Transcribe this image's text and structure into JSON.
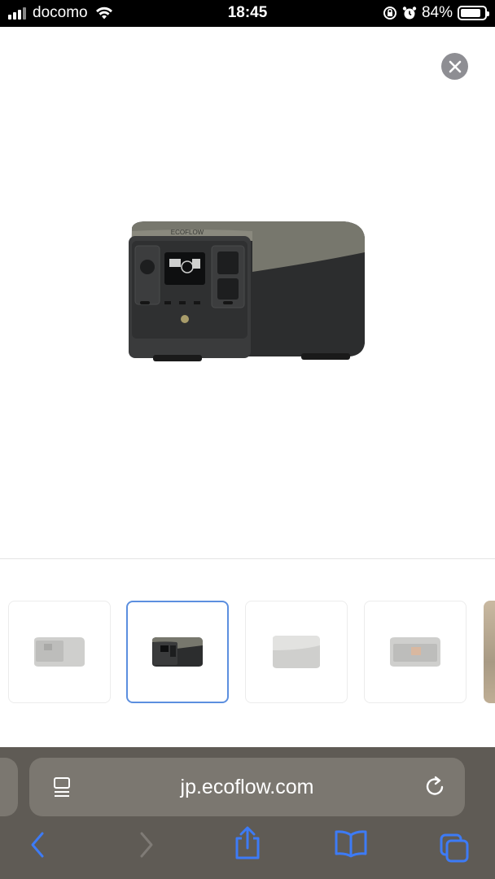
{
  "status_bar": {
    "carrier": "docomo",
    "time": "18:45",
    "battery_percent": "84%",
    "battery_level": 0.84,
    "icons": [
      "signal-icon",
      "wifi-icon",
      "orientation-lock-icon",
      "alarm-icon",
      "battery-icon"
    ]
  },
  "viewer": {
    "close_icon": "close-icon",
    "main_image_alt": "ECOFLOW portable power station",
    "thumbnails": [
      {
        "name": "thumbnail-1",
        "selected": false
      },
      {
        "name": "thumbnail-2",
        "selected": true
      },
      {
        "name": "thumbnail-3",
        "selected": false
      },
      {
        "name": "thumbnail-4",
        "selected": false
      },
      {
        "name": "thumbnail-5",
        "selected": false
      }
    ],
    "selected_color": "#5c8fdf"
  },
  "safari": {
    "url": "jp.ecoflow.com",
    "reader_icon": "reader-icon",
    "reload_icon": "reload-icon",
    "toolbar": [
      "back-icon",
      "forward-icon",
      "share-icon",
      "bookmarks-icon",
      "tabs-icon"
    ],
    "accent": "#3d7bf6"
  },
  "device_label": "ECOFLOW"
}
